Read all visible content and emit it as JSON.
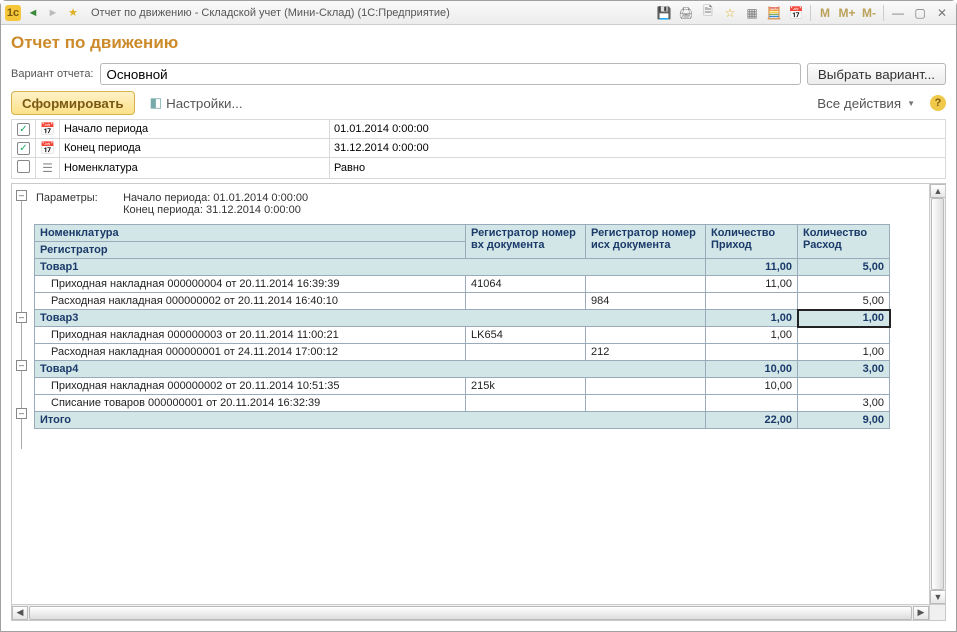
{
  "window": {
    "title": "Отчет по движению - Складской учет (Мини-Склад)  (1С:Предприятие)"
  },
  "page": {
    "title": "Отчет по движению"
  },
  "variant": {
    "label": "Вариант отчета:",
    "value": "Основной",
    "choose_btn": "Выбрать вариант..."
  },
  "toolbar": {
    "generate": "Сформировать",
    "settings": "Настройки...",
    "all_actions": "Все действия"
  },
  "params_table": [
    {
      "checked": true,
      "icon": "calendar",
      "name": "Начало периода",
      "value": "01.01.2014 0:00:00"
    },
    {
      "checked": true,
      "icon": "calendar",
      "name": "Конец периода",
      "value": "31.12.2014 0:00:00"
    },
    {
      "checked": false,
      "icon": "list",
      "name": "Номенклатура",
      "value": "Равно"
    }
  ],
  "report": {
    "params_label": "Параметры:",
    "params_lines": [
      "Начало периода: 01.01.2014 0:00:00",
      "Конец периода: 31.12.2014 0:00:00"
    ],
    "headers": {
      "nomen": "Номенклатура",
      "registrar": "Регистратор",
      "reg_in": "Регистратор номер вх документа",
      "reg_out": "Регистратор номер исх документа",
      "qty_in": "Количество Приход",
      "qty_out": "Количество Расход"
    },
    "groups": [
      {
        "name": "Товар1",
        "qty_in": "11,00",
        "qty_out": "5,00",
        "rows": [
          {
            "reg": "Приходная накладная 000000004 от 20.11.2014 16:39:39",
            "in_doc": "41064",
            "out_doc": "",
            "qty_in": "11,00",
            "qty_out": ""
          },
          {
            "reg": "Расходная накладная 000000002 от 20.11.2014 16:40:10",
            "in_doc": "",
            "out_doc": "984",
            "qty_in": "",
            "qty_out": "5,00"
          }
        ]
      },
      {
        "name": "Товар3",
        "qty_in": "1,00",
        "qty_out": "1,00",
        "qty_out_hl": true,
        "rows": [
          {
            "reg": "Приходная накладная 000000003 от 20.11.2014 11:00:21",
            "in_doc": "LK654",
            "out_doc": "",
            "qty_in": "1,00",
            "qty_out": ""
          },
          {
            "reg": "Расходная накладная 000000001 от 24.11.2014 17:00:12",
            "in_doc": "",
            "out_doc": "212",
            "qty_in": "",
            "qty_out": "1,00"
          }
        ]
      },
      {
        "name": "Товар4",
        "qty_in": "10,00",
        "qty_out": "3,00",
        "rows": [
          {
            "reg": "Приходная накладная 000000002 от 20.11.2014 10:51:35",
            "in_doc": "215k",
            "out_doc": "",
            "qty_in": "10,00",
            "qty_out": ""
          },
          {
            "reg": "Списание товаров 000000001 от 20.11.2014 16:32:39",
            "in_doc": "",
            "out_doc": "",
            "qty_in": "",
            "qty_out": "3,00"
          }
        ]
      }
    ],
    "total": {
      "label": "Итого",
      "qty_in": "22,00",
      "qty_out": "9,00"
    }
  }
}
